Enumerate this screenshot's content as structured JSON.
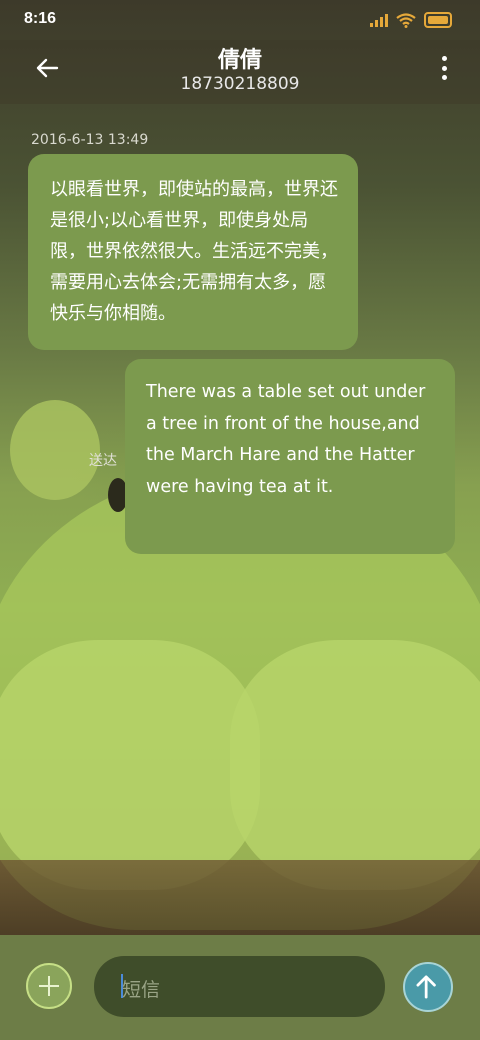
{
  "status_bar": {
    "time": "8:16"
  },
  "header": {
    "contact_name": "倩倩",
    "contact_number": "18730218809"
  },
  "conversation": {
    "timestamp": "2016-6-13 13:49",
    "messages": [
      {
        "direction": "incoming",
        "text": "以眼看世界，即使站的最高，世界还是很小;以心看世界，即使身处局限，世界依然很大。生活远不完美，需要用心去体会;无需拥有太多，愿快乐与你相随。"
      },
      {
        "direction": "outgoing",
        "text": "There was a table set out under a tree in front of the house,and the March Hare and the Hatter were having tea at it.",
        "status": "送达"
      }
    ]
  },
  "composer": {
    "placeholder": "短信"
  },
  "icons": {
    "back": "arrow-left-icon",
    "more": "more-vertical-icon",
    "add": "plus-icon",
    "send": "arrow-up-icon"
  },
  "colors": {
    "bubble": "#7c9a4e",
    "status_accent": "#e6a93a",
    "send": "#4a9aa8"
  }
}
